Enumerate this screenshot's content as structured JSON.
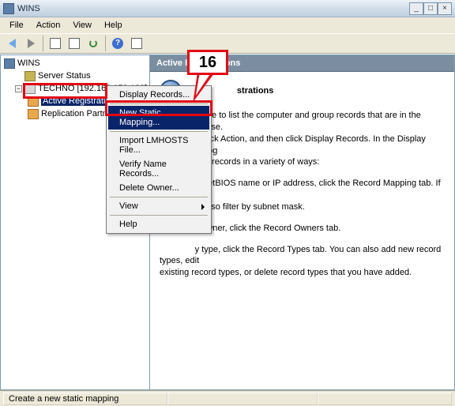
{
  "window": {
    "title": "WINS"
  },
  "menus": {
    "file": "File",
    "action": "Action",
    "view": "View",
    "help": "Help"
  },
  "tree": {
    "root": "WINS",
    "server_status": "Server Status",
    "server": "TECHNO [192.168.158.128]",
    "active_reg": "Active Registrations",
    "replication": "Replication Partners"
  },
  "content": {
    "header": "Active Registrations",
    "title_fragment": "strations",
    "p1_a": "ace to list the computer and group records that are in the WINS database.",
    "p1_b": "click Action, and then click Display Records. In the Display Records dialog",
    "p1_c": "the records in a variety of ways:",
    "p2_a": "y NetBIOS name or IP address, click the Record Mapping tab. If you filter by",
    "p2_b": "n also filter by subnet mask.",
    "p3": "y owner, click the Record Owners tab.",
    "p4_a": "y type, click the Record Types tab. You can also add new record types, edit",
    "p4_b": "existing record types, or delete record types that you have added."
  },
  "context_menu": {
    "display_records": "Display Records...",
    "new_static": "New Static Mapping...",
    "import_lmhosts": "Import LMHOSTS File...",
    "verify_name": "Verify Name Records...",
    "delete_owner": "Delete Owner...",
    "view": "View",
    "help": "Help"
  },
  "callout": {
    "step": "16"
  },
  "statusbar": {
    "text": "Create a new static mapping"
  }
}
